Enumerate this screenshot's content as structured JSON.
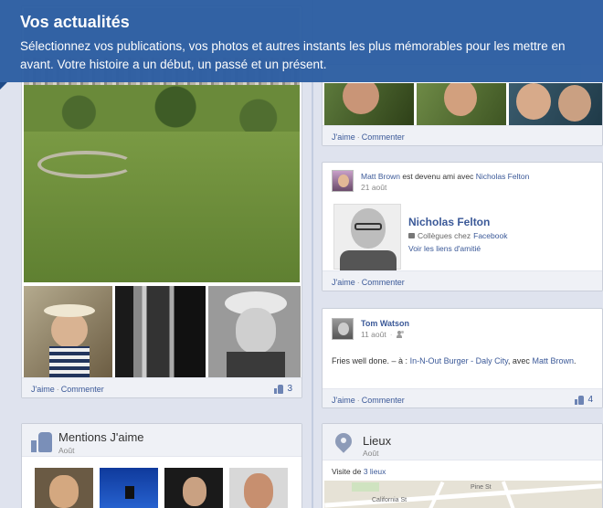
{
  "banner": {
    "title": "Vos actualités",
    "text": "Sélectionnez vos publications, vos photos et autres instants les plus mémorables pour les mettre en avant. Votre histoire a un début, un passé et un présent."
  },
  "left_photo_post": {
    "like_label": "J'aime",
    "comment_label": "Commenter",
    "likes": "3"
  },
  "top_right_post": {
    "like_label": "J'aime",
    "comment_label": "Commenter"
  },
  "friend_post": {
    "actor": "Matt Brown",
    "verb": "est devenu ami avec",
    "friend": "Nicholas Felton",
    "date": "21 août",
    "friend_name": "Nicholas Felton",
    "colleagues_prefix": "Collègues chez",
    "company": "Facebook",
    "friendship_link": "Voir les liens d'amitié",
    "like_label": "J'aime",
    "comment_label": "Commenter"
  },
  "status_post": {
    "author": "Tom Watson",
    "date": "11 août",
    "text_prefix": "Fries well done. – à :",
    "place": "In-N-Out Burger - Daly City",
    "with_prefix": ", avec",
    "with_person": "Matt Brown",
    "like_label": "J'aime",
    "comment_label": "Commenter",
    "likes": "4"
  },
  "likes_section": {
    "title": "Mentions J'aime",
    "subtitle": "Août"
  },
  "places_section": {
    "title": "Lieux",
    "subtitle": "Août",
    "visit_prefix": "Visite de",
    "visit_link": "3 lieux",
    "map_labels": [
      "California St",
      "Pine St"
    ]
  },
  "icons": {
    "thumb": "thumbs-up-icon",
    "pin": "map-pin-icon",
    "briefcase": "briefcase-icon",
    "friends": "friends-icon"
  },
  "colors": {
    "banner": "#2e5fa3",
    "link": "#3b5998",
    "timeline": "#dfe3ee"
  }
}
